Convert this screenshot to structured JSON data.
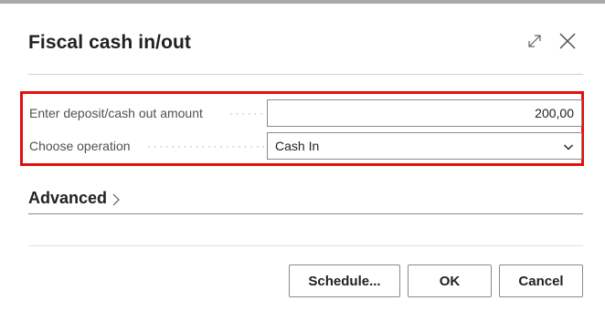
{
  "dialog": {
    "title": "Fiscal cash in/out",
    "icons": {
      "expand": "expand-icon",
      "close": "close-icon"
    }
  },
  "fields": {
    "amount": {
      "label": "Enter deposit/cash out amount",
      "value": "200,00"
    },
    "operation": {
      "label": "Choose operation",
      "value": "Cash In"
    }
  },
  "advanced": {
    "label": "Advanced"
  },
  "buttons": {
    "schedule": "Schedule...",
    "ok": "OK",
    "cancel": "Cancel"
  },
  "colors": {
    "highlight_border": "#e41010",
    "text": "#212121",
    "label": "#505050"
  }
}
